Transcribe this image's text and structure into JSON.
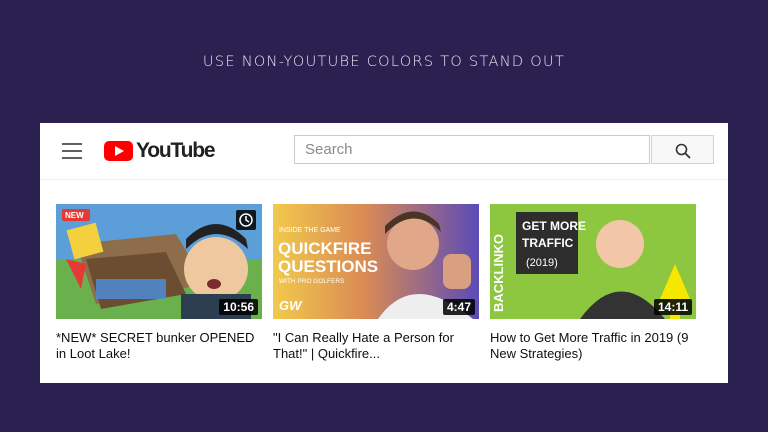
{
  "headline": "USE NON-YOUTUBE COLORS TO STAND OUT",
  "header": {
    "logo_text": "YouTube",
    "search_placeholder": "Search"
  },
  "videos": [
    {
      "title": "*NEW* SECRET bunker OPENED in Loot Lake!",
      "duration": "10:56",
      "thumb_badge": "NEW"
    },
    {
      "title": "\"I Can Really Hate a Person for That!\" | Quickfire...",
      "duration": "4:47",
      "thumb_kicker": "INSIDE THE GAME",
      "thumb_line1": "QUICKFIRE",
      "thumb_line2": "QUESTIONS",
      "thumb_sub": "WITH PRO GOLFERS",
      "thumb_logo": "GW"
    },
    {
      "title": "How to Get More Traffic in 2019 (9 New Strategies)",
      "duration": "14:11",
      "thumb_side": "BACKLINKO",
      "thumb_line1": "GET MORE",
      "thumb_line2": "TRAFFIC",
      "thumb_line3": "(2019)"
    }
  ],
  "colors": {
    "background": "#2b2150",
    "brand_red": "#ff0000",
    "thumb3_green": "#8dc63f"
  }
}
